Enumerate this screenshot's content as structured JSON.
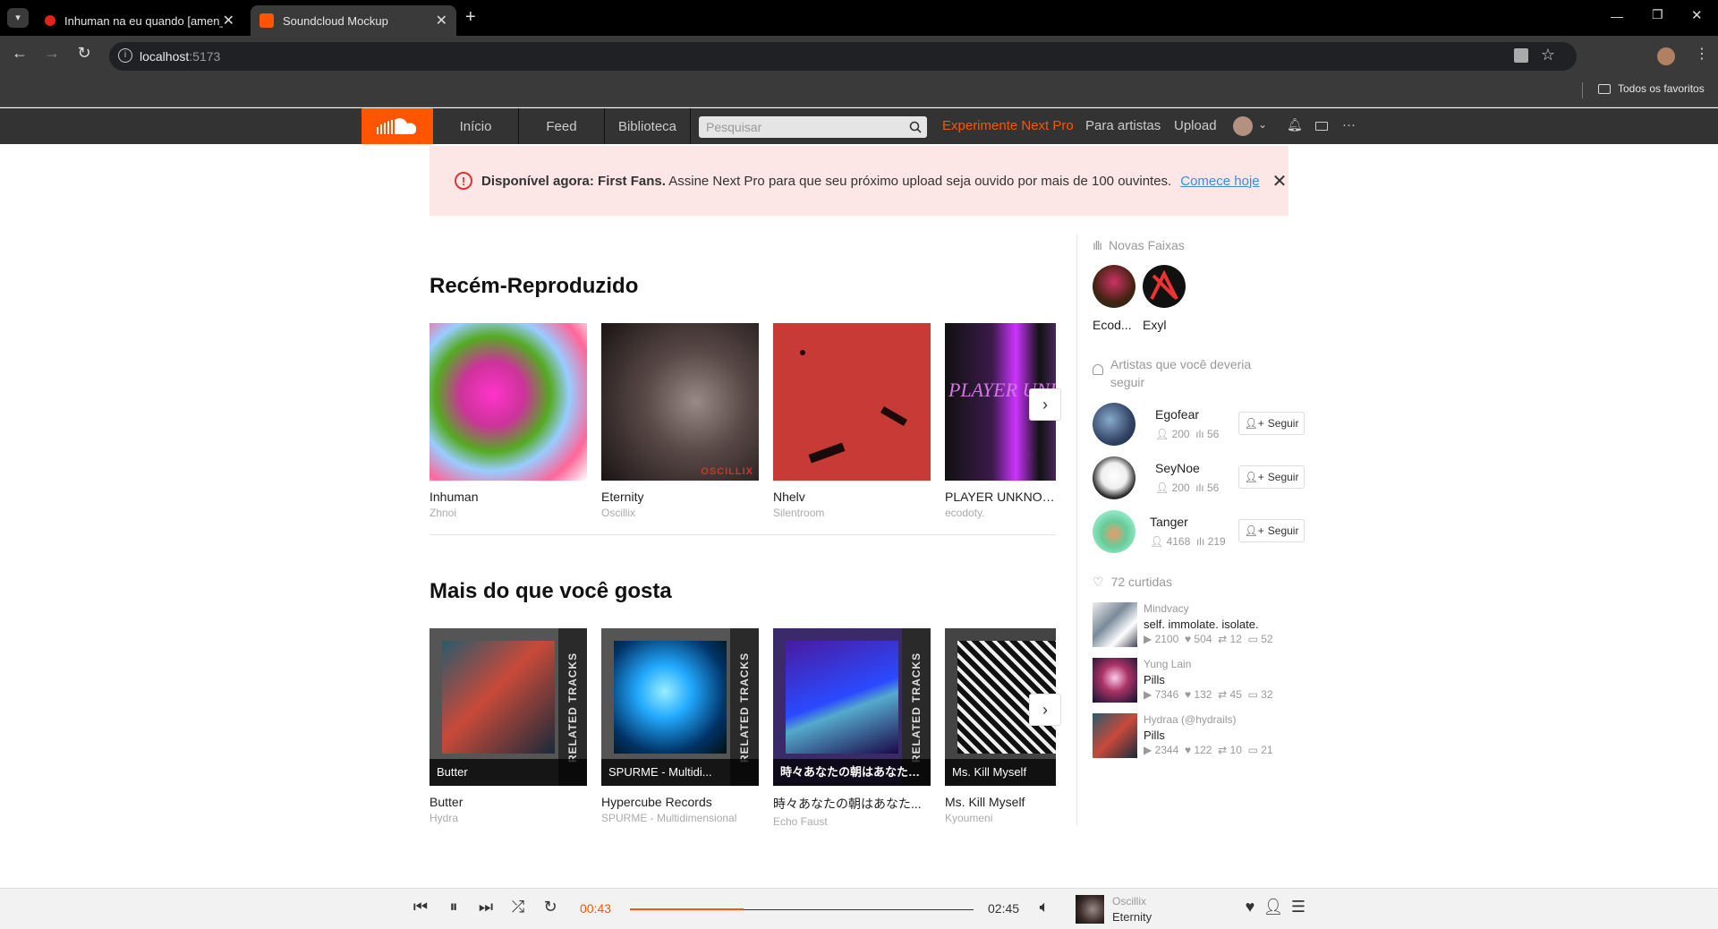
{
  "browser": {
    "tabs": [
      {
        "title": "Inhuman na eu quando [amen_"
      },
      {
        "title": "Soundcloud Mockup"
      }
    ],
    "url_host": "localhost",
    "url_port": ":5173",
    "bookmarks_label": "Todos os favoritos"
  },
  "header": {
    "nav": [
      "Início",
      "Feed",
      "Biblioteca"
    ],
    "search_placeholder": "Pesquisar",
    "pro_link": "Experimente Next Pro",
    "artists_link": "Para artistas",
    "upload_link": "Upload",
    "more": "···",
    "brand_color": "#ff5500"
  },
  "banner": {
    "bold": "Disponível agora: First Fans.",
    "text": " Assine Next Pro para que seu próximo upload seja ouvido por mais de 100 ouvintes.",
    "link": "Comece hoje"
  },
  "recent": {
    "title": "Recém-Reproduzido",
    "items": [
      {
        "title": "Inhuman",
        "artist": "Zhnoi"
      },
      {
        "title": "Eternity",
        "artist": "Oscillix",
        "cover_text": "OSCILLIX"
      },
      {
        "title": "Nhelv",
        "artist": "Silentroom"
      },
      {
        "title": "PLAYER UNKNOWN",
        "artist": "ecodoty.",
        "cover_text": "PLAYER UNKNO"
      }
    ]
  },
  "more": {
    "title": "Mais do que você gosta",
    "related_label": "RELATED TRACKS",
    "items": [
      {
        "label": "Butter",
        "title": "Butter",
        "artist": "Hydra"
      },
      {
        "label": "SPURME - Multidi...",
        "title": "Hypercube Records",
        "artist": "SPURME - Multidimensional"
      },
      {
        "label": "時々あなたの朝はあなたが望む",
        "title": "時々あなたの朝はあなた...",
        "artist": "Echo Faust"
      },
      {
        "label": "Ms. Kill Myself",
        "title": "Ms. Kill Myself",
        "artist": "Kyoumeni"
      }
    ]
  },
  "sidebar": {
    "new_tracks_title": "Novas Faixas",
    "new_tracks": [
      {
        "name": "Ecod..."
      },
      {
        "name": "Exyl"
      }
    ],
    "follow_title": "Artistas que você deveria seguir",
    "follow_label": "Seguir",
    "artists": [
      {
        "name": "Egofear",
        "followers": "200",
        "tracks": "56"
      },
      {
        "name": "SeyNoe",
        "followers": "200",
        "tracks": "56"
      },
      {
        "name": "Tanger",
        "followers": "4168",
        "tracks": "219"
      }
    ],
    "likes_title": "72 curtidas",
    "likes": [
      {
        "artist": "Mindvacy",
        "title": "self. immolate. isolate.",
        "plays": "2100",
        "likes": "504",
        "reposts": "12",
        "comments": "52"
      },
      {
        "artist": "Yung Lain",
        "title": "Pills",
        "plays": "7346",
        "likes": "132",
        "reposts": "45",
        "comments": "32"
      },
      {
        "artist": "Hydraa (@hydrails)",
        "title": "Pills",
        "plays": "2344",
        "likes": "122",
        "reposts": "10",
        "comments": "21"
      }
    ]
  },
  "player": {
    "current": "00:43",
    "duration": "02:45",
    "progress": 0.33,
    "artist": "Oscillix",
    "title": "Eternity"
  }
}
